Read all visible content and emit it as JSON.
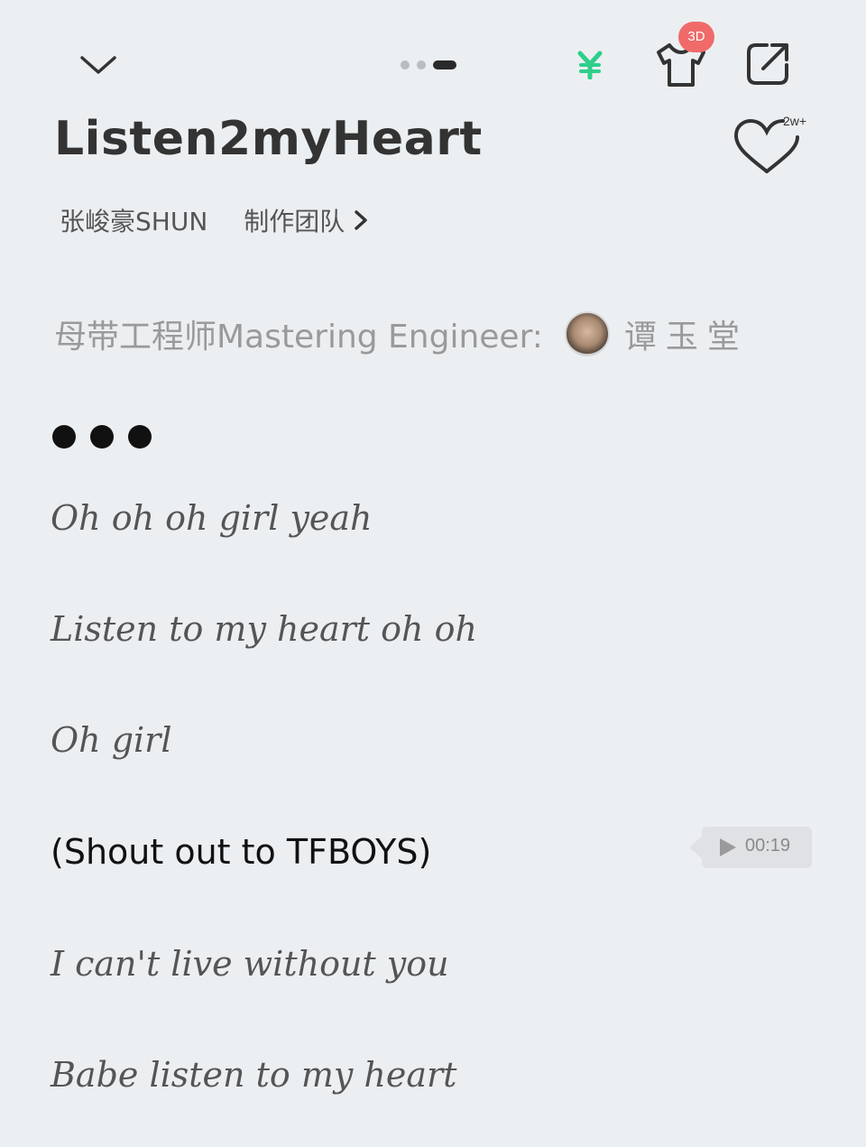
{
  "header": {
    "collapse_icon": "chevron-down-icon",
    "yen_icon": "yen-icon",
    "shirt_icon": "tshirt-icon",
    "shirt_badge": "3D",
    "share_icon": "share-icon",
    "page_indicator": {
      "total": 3,
      "active": 3
    }
  },
  "song": {
    "title": "Listen2myHeart",
    "artist": "张峻豪SHUN",
    "team_link": "制作团队",
    "like_count": "2w+"
  },
  "credit": {
    "role": "母带工程师Mastering Engineer:",
    "name": "谭玉堂"
  },
  "lyrics": [
    "Oh oh oh girl yeah",
    "Listen to my heart oh oh",
    "Oh girl",
    "(Shout out to TFBOYS)",
    "I can't live without you",
    "Babe listen to my heart"
  ],
  "current_lyric_index": 3,
  "playback": {
    "time": "00:19"
  },
  "colors": {
    "background": "#eceff2",
    "badge": "#f06a6a",
    "yen": "#2ecf8a"
  }
}
